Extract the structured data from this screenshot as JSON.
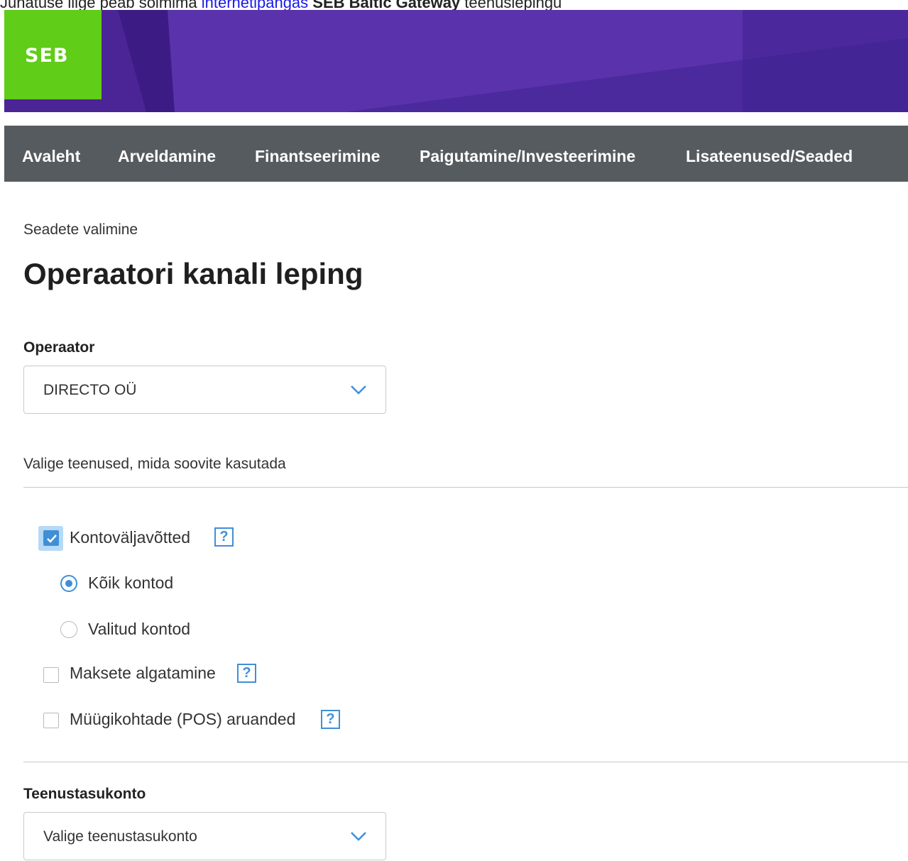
{
  "intro": {
    "prefix": "Juhatuse liige peab sõlmima ",
    "link": "internetipangas",
    "bold": "SEB Baltic Gateway",
    "suffix": " teenuslepingu"
  },
  "logo": "SEB",
  "colors": {
    "brand_green": "#60cd18",
    "banner_purple": "#4b2596",
    "nav_gray": "#565b5f",
    "accent_blue": "#3f8fd8"
  },
  "nav": {
    "items": [
      "Avaleht",
      "Arveldamine",
      "Finantseerimine",
      "Paigutamine/Investeerimine",
      "Lisateenused/Seaded"
    ]
  },
  "breadcrumb": "Seadete valimine",
  "page_title": "Operaatori kanali leping",
  "operator": {
    "label": "Operaator",
    "value": "DIRECTO OÜ"
  },
  "services": {
    "hint": "Valige teenused, mida soovite kasutada",
    "statements": {
      "label": "Kontoväljavõtted",
      "checked": true
    },
    "account_options": [
      {
        "label": "Kõik kontod",
        "selected": true
      },
      {
        "label": "Valitud kontod",
        "selected": false
      }
    ],
    "payments": {
      "label": "Maksete algatamine",
      "checked": false
    },
    "pos": {
      "label": "Müügikohtade (POS) aruanded",
      "checked": false
    },
    "help_symbol": "?"
  },
  "fee_account": {
    "label": "Teenustasukonto",
    "placeholder": "Valige teenustasukonto"
  },
  "icons": {
    "chevron": "chevron-down-icon",
    "help": "help-icon",
    "check": "check-icon"
  }
}
